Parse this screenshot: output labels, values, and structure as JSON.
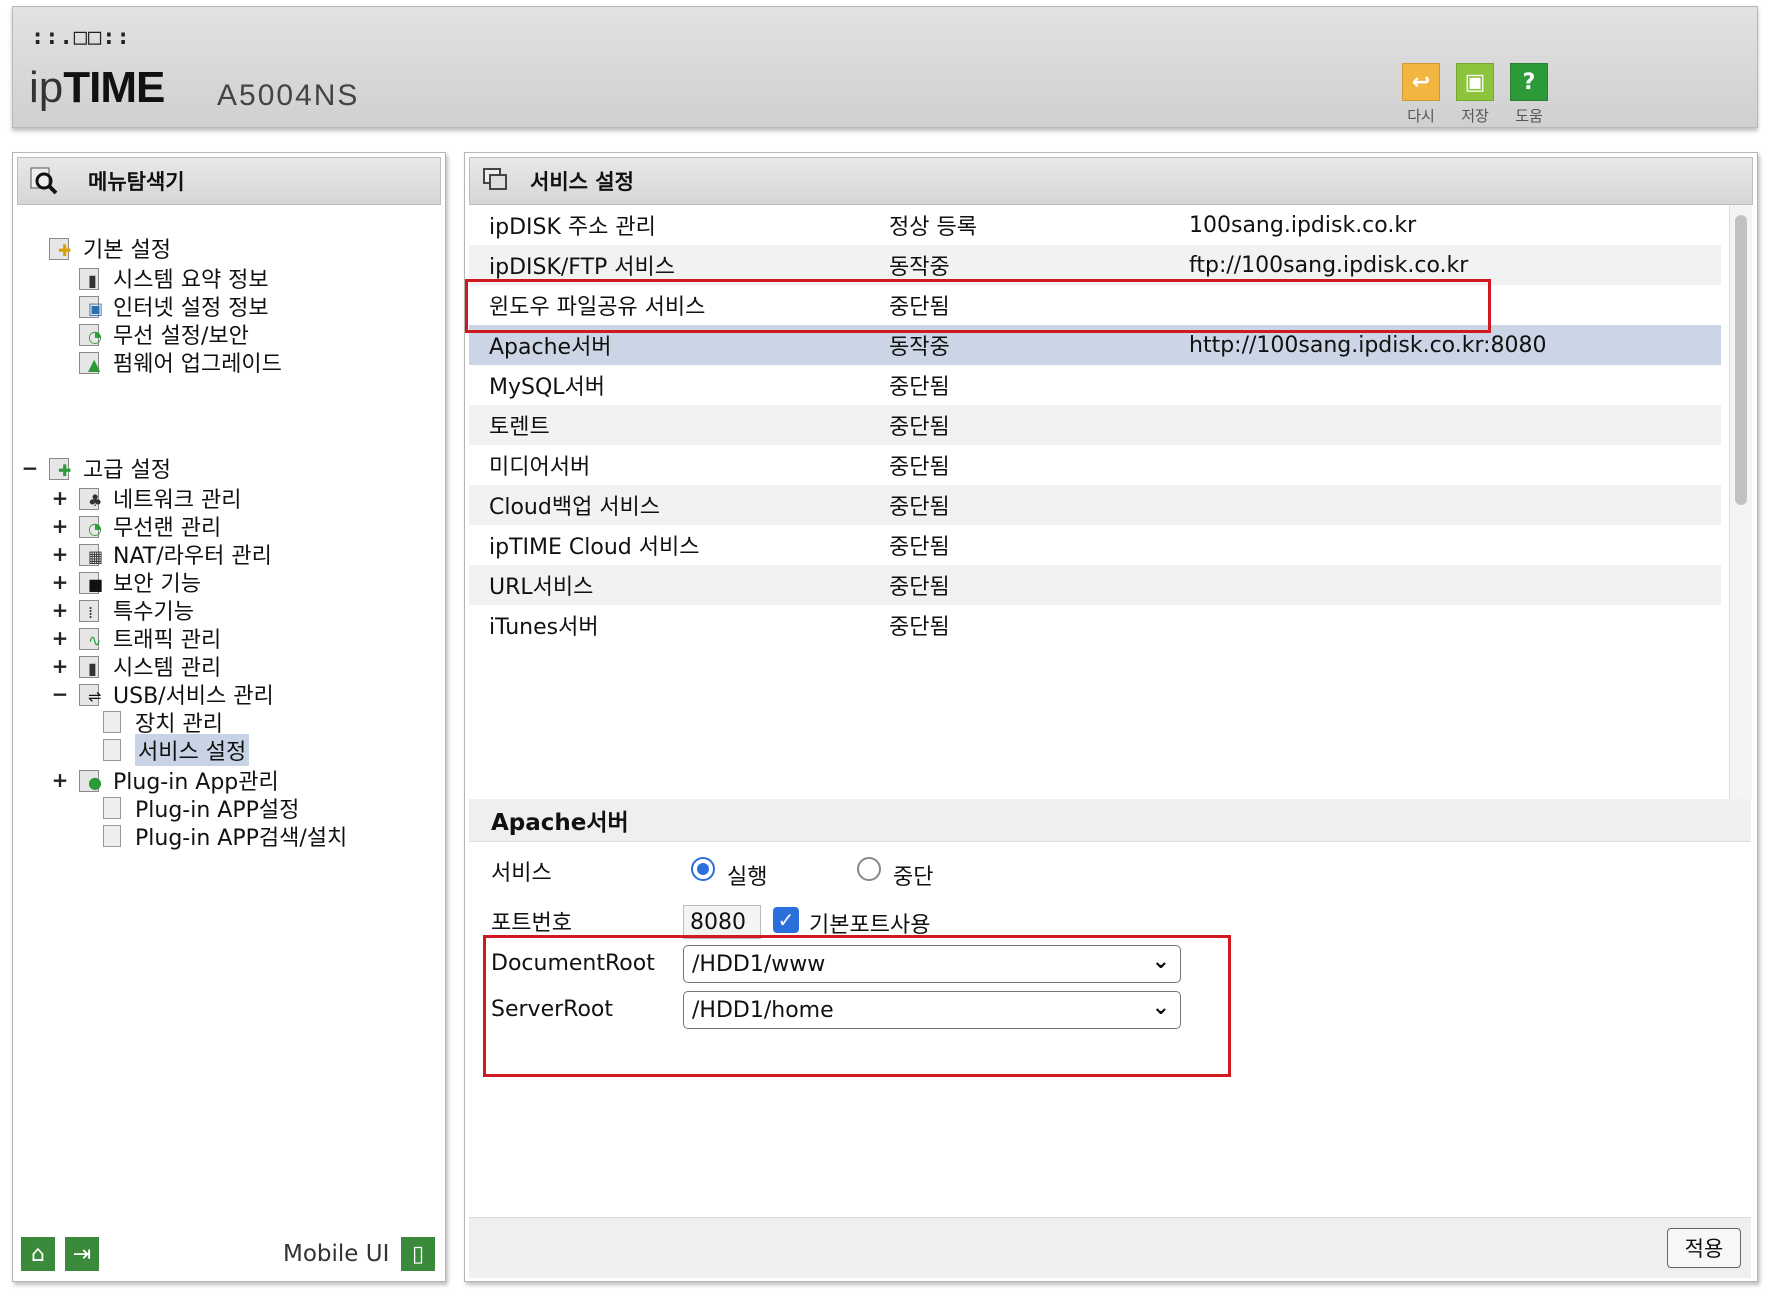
{
  "header": {
    "logo_dots": "::.□□::",
    "brand_prefix": "ip",
    "brand_main": "TIME",
    "model": "A5004NS",
    "tools": [
      {
        "label": "다시",
        "icon": "undo-icon",
        "color": "#f2b640",
        "glyph": "↩"
      },
      {
        "label": "저장",
        "icon": "save-icon",
        "color": "#8cc43c",
        "glyph": "▣"
      },
      {
        "label": "도움",
        "icon": "help-icon",
        "color": "#2d9a3a",
        "glyph": "?"
      }
    ]
  },
  "left": {
    "title": "메뉴탐색기",
    "basic": {
      "label": "기본 설정",
      "items": [
        "시스템 요약 정보",
        "인터넷 설정 정보",
        "무선 설정/보안",
        "펌웨어 업그레이드"
      ]
    },
    "advanced": {
      "toggle": "−",
      "label": "고급 설정",
      "items": [
        {
          "toggle": "+",
          "label": "네트워크 관리"
        },
        {
          "toggle": "+",
          "label": "무선랜 관리"
        },
        {
          "toggle": "+",
          "label": "NAT/라우터 관리"
        },
        {
          "toggle": "+",
          "label": "보안 기능"
        },
        {
          "toggle": "+",
          "label": "특수기능"
        },
        {
          "toggle": "+",
          "label": "트래픽 관리"
        },
        {
          "toggle": "+",
          "label": "시스템 관리"
        },
        {
          "toggle": "−",
          "label": "USB/서비스 관리"
        }
      ],
      "usb_children": [
        "장치 관리",
        "서비스 설정"
      ],
      "plugin": {
        "toggle": "+",
        "label": "Plug-in App관리"
      },
      "plugin_children": [
        "Plug-in APP설정",
        "Plug-in APP검색/설치"
      ]
    },
    "footer": {
      "mobile_label": "Mobile UI"
    }
  },
  "right": {
    "title": "서비스 설정",
    "services": [
      {
        "name": "ipDISK 주소 관리",
        "status": "정상 등록",
        "url": "100sang.ipdisk.co.kr"
      },
      {
        "name": "ipDISK/FTP 서비스",
        "status": "동작중",
        "url": "ftp://100sang.ipdisk.co.kr"
      },
      {
        "name": "윈도우 파일공유 서비스",
        "status": "중단됨",
        "url": ""
      },
      {
        "name": "Apache서버",
        "status": "동작중",
        "url": "http://100sang.ipdisk.co.kr:8080"
      },
      {
        "name": "MySQL서버",
        "status": "중단됨",
        "url": ""
      },
      {
        "name": "토렌트",
        "status": "중단됨",
        "url": ""
      },
      {
        "name": "미디어서버",
        "status": "중단됨",
        "url": ""
      },
      {
        "name": "Cloud백업 서비스",
        "status": "중단됨",
        "url": ""
      },
      {
        "name": "ipTIME Cloud 서비스",
        "status": "중단됨",
        "url": ""
      },
      {
        "name": "URL서비스",
        "status": "중단됨",
        "url": ""
      },
      {
        "name": "iTunes서버",
        "status": "중단됨",
        "url": ""
      }
    ],
    "selected_service": "Apache서버",
    "detail": {
      "title": "Apache서버",
      "service_label": "서비스",
      "run_label": "실행",
      "stop_label": "중단",
      "service_state": "실행",
      "port_label": "포트번호",
      "port_value": "8080",
      "default_port_label": "기본포트사용",
      "default_port_checked": true,
      "docroot_label": "DocumentRoot",
      "docroot_value": "/HDD1/www",
      "serverroot_label": "ServerRoot",
      "serverroot_value": "/HDD1/home"
    },
    "apply_label": "적용"
  },
  "highlight_color": "#d01a22"
}
